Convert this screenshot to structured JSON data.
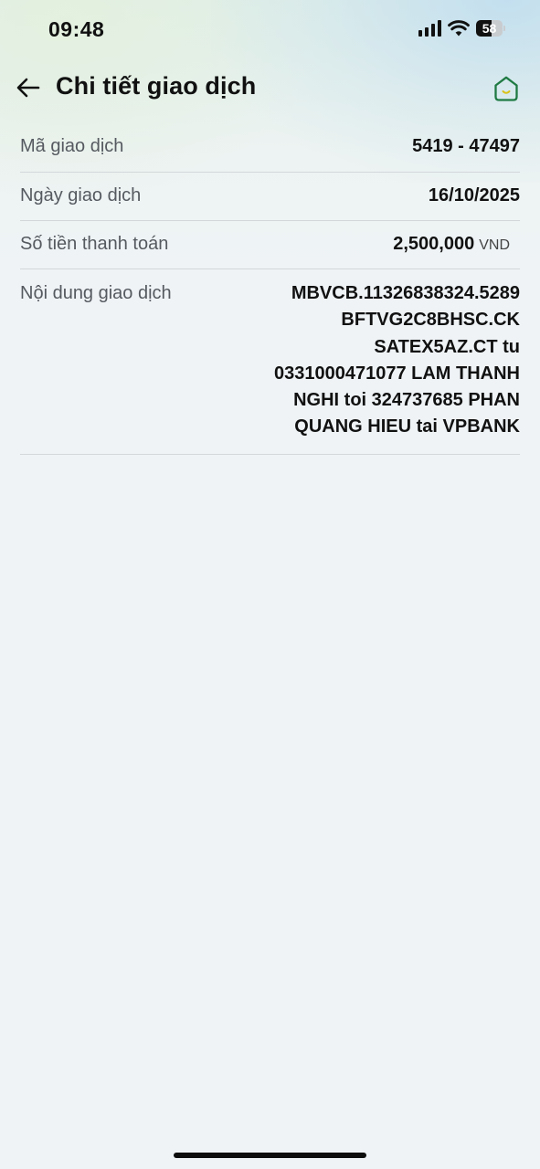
{
  "status_bar": {
    "time": "09:48",
    "battery_level": "58",
    "icons": [
      "signal-icon",
      "wifi-icon",
      "battery-icon"
    ]
  },
  "header": {
    "title": "Chi tiết giao dịch",
    "back_icon": "arrow-left-icon",
    "home_icon": "home-icon"
  },
  "details": [
    {
      "label": "Mã giao dịch",
      "value": "5419 - 47497"
    },
    {
      "label": "Ngày giao dịch",
      "value": "16/10/2025"
    },
    {
      "label": "Số tiền thanh toán",
      "value": "2,500,000",
      "unit": "VND"
    },
    {
      "label": "Nội dung giao dịch",
      "value": "MBVCB.11326838324.5289 BFTVG2C8BHSC.CK SATEX5AZ.CT tu 0331000471077 LAM THANH NGHI toi 324737685 PHAN QUANG HIEU tai VPBANK"
    }
  ],
  "colors": {
    "accent_green": "#1f7a43",
    "text_primary": "#111111",
    "text_label": "#555a60",
    "divider": "#d3d7da"
  }
}
